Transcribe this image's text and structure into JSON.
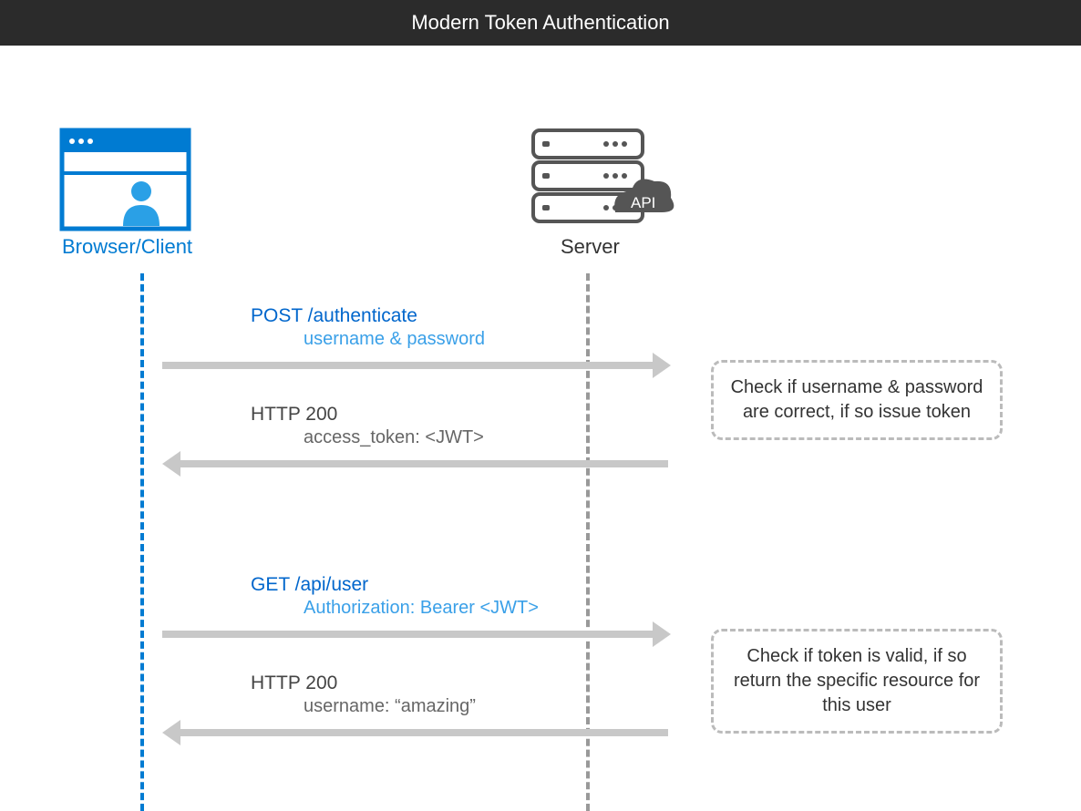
{
  "header": {
    "title": "Modern Token Authentication"
  },
  "participants": {
    "client": {
      "label": "Browser/Client"
    },
    "server": {
      "label": "Server",
      "badge": "API"
    }
  },
  "messages": [
    {
      "direction": "right",
      "title": "POST /authenticate",
      "subtitle": "username & password"
    },
    {
      "direction": "left",
      "title": "HTTP 200",
      "subtitle": "access_token: <JWT>"
    },
    {
      "direction": "right",
      "title": "GET /api/user",
      "subtitle": "Authorization: Bearer <JWT>"
    },
    {
      "direction": "left",
      "title": "HTTP 200",
      "subtitle": "username: “amazing”"
    }
  ],
  "notes": [
    {
      "text": "Check if username & password are correct, if so issue token"
    },
    {
      "text": "Check if token is valid, if so return the specific resource for this user"
    }
  ]
}
